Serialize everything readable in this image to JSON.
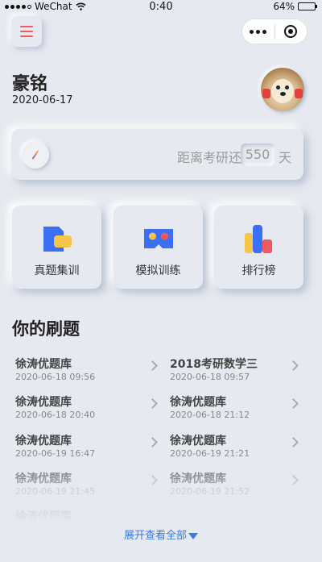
{
  "status_bar": {
    "carrier": "WeChat",
    "time": "0:40",
    "battery": "64%",
    "battery_level": 0.64
  },
  "profile": {
    "name": "豪铭",
    "date": "2020-06-17"
  },
  "countdown": {
    "prefix": "距离考研还有",
    "days": "550",
    "unit": "天"
  },
  "features": [
    {
      "label": "真题集训",
      "icon": "folder-icon"
    },
    {
      "label": "模拟训练",
      "icon": "vr-headset-icon"
    },
    {
      "label": "排行榜",
      "icon": "bar-chart-icon"
    }
  ],
  "practice": {
    "title": "你的刷题",
    "items": [
      {
        "name": "徐涛优题库",
        "time": "2020-06-18 09:56"
      },
      {
        "name": "2018考研数学三",
        "time": "2020-06-18 09:57"
      },
      {
        "name": "徐涛优题库",
        "time": "2020-06-18 20:40"
      },
      {
        "name": "徐涛优题库",
        "time": "2020-06-18 21:12"
      },
      {
        "name": "徐涛优题库",
        "time": "2020-06-19 16:47"
      },
      {
        "name": "徐涛优题库",
        "time": "2020-06-19 21:21"
      },
      {
        "name": "徐涛优题库",
        "time": "2020-06-19 21:45"
      },
      {
        "name": "徐涛优题库",
        "time": "2020-06-19 21:52"
      },
      {
        "name": "徐涛优题库",
        "time": ""
      }
    ],
    "expand_label": "展开查看全部"
  },
  "colors": {
    "background": "#e6e9ef",
    "accent_red": "#f05a5a",
    "link_blue": "#3a7be0"
  }
}
